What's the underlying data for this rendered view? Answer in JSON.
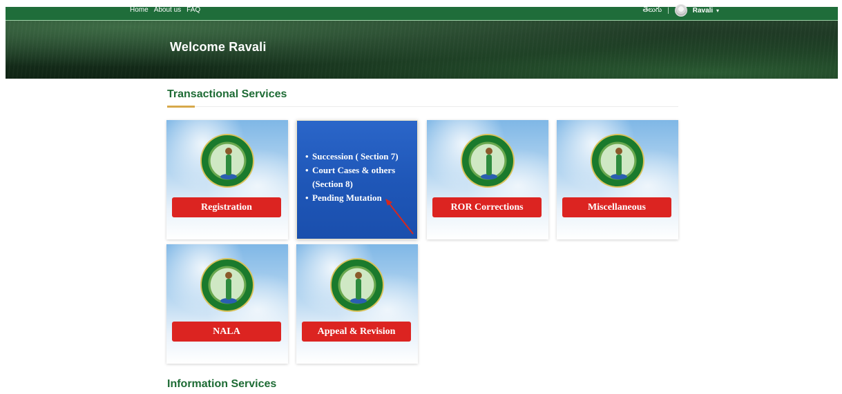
{
  "topbar": {
    "links": [
      "Home",
      "About us",
      "FAQ"
    ],
    "language": "తెలుగు",
    "separator": "|",
    "user_name": "Ravali",
    "caret": "▾"
  },
  "hero": {
    "title": "Welcome  Ravali"
  },
  "sections": {
    "transactional": "Transactional Services",
    "information": "Information Services"
  },
  "cards": [
    {
      "label": "Registration"
    },
    {
      "info_items": [
        "Succession ( Section 7)",
        "Court Cases & others (Section 8)",
        "Pending Mutation"
      ]
    },
    {
      "label": "ROR Corrections"
    },
    {
      "label": "Miscellaneous"
    },
    {
      "label": "NALA"
    },
    {
      "label": "Appeal & Revision"
    }
  ],
  "colors": {
    "brand_green": "#1f6d3a",
    "heading_green": "#1d6b34",
    "button_red": "#dc2421",
    "info_blue": "#2056b6",
    "accent_gold": "#d7a84a",
    "annotation_arrow": "#d6281f"
  }
}
